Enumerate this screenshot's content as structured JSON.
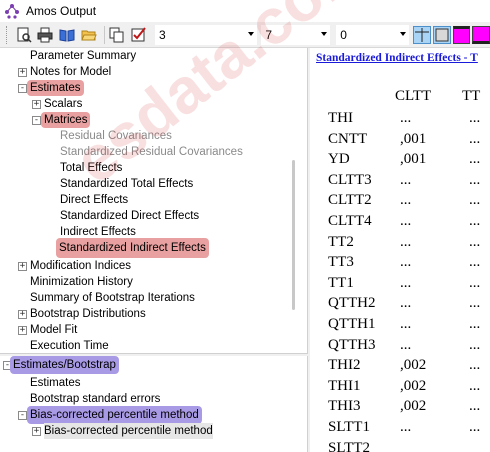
{
  "window": {
    "title": "Amos Output"
  },
  "toolbar": {
    "combo1": "3",
    "combo2": "7",
    "combo3": "0"
  },
  "tree_top": [
    {
      "label": "Parameter Summary"
    },
    {
      "label": "Notes for Model"
    },
    {
      "label": "Estimates"
    },
    {
      "label": "Scalars"
    },
    {
      "label": "Matrices"
    },
    {
      "label": "Residual Covariances"
    },
    {
      "label": "Standardized Residual Covariances"
    },
    {
      "label": "Total Effects"
    },
    {
      "label": "Standardized Total Effects"
    },
    {
      "label": "Direct Effects"
    },
    {
      "label": "Standardized Direct Effects"
    },
    {
      "label": "Indirect Effects"
    },
    {
      "label": "Standardized Indirect Effects"
    },
    {
      "label": "Modification Indices"
    },
    {
      "label": "Minimization History"
    },
    {
      "label": "Summary of Bootstrap Iterations"
    },
    {
      "label": "Bootstrap Distributions"
    },
    {
      "label": "Model Fit"
    },
    {
      "label": "Execution Time"
    }
  ],
  "tree_bottom": [
    {
      "label": "Estimates/Bootstrap"
    },
    {
      "label": "Estimates"
    },
    {
      "label": "Bootstrap standard errors"
    },
    {
      "label": "Bias-corrected percentile method"
    },
    {
      "label": "Bias-corrected percentile method"
    }
  ],
  "report": {
    "section_link": "Standardized Indirect Effects - T",
    "columns": [
      "CLTT",
      "TT"
    ],
    "rows": [
      {
        "name": "THI",
        "cltt": "...",
        "tt": "..."
      },
      {
        "name": "CNTT",
        "cltt": ",001",
        "tt": "..."
      },
      {
        "name": "YD",
        "cltt": ",001",
        "tt": "..."
      },
      {
        "name": "CLTT3",
        "cltt": "...",
        "tt": "..."
      },
      {
        "name": "CLTT2",
        "cltt": "...",
        "tt": "..."
      },
      {
        "name": "CLTT4",
        "cltt": "...",
        "tt": "..."
      },
      {
        "name": "TT2",
        "cltt": "...",
        "tt": "..."
      },
      {
        "name": "TT3",
        "cltt": "...",
        "tt": "..."
      },
      {
        "name": "TT1",
        "cltt": "...",
        "tt": "..."
      },
      {
        "name": "QTTH2",
        "cltt": "...",
        "tt": "..."
      },
      {
        "name": "QTTH1",
        "cltt": "...",
        "tt": "..."
      },
      {
        "name": "QTTH3",
        "cltt": "...",
        "tt": "..."
      },
      {
        "name": "THI2",
        "cltt": ",002",
        "tt": "..."
      },
      {
        "name": "THI1",
        "cltt": ",002",
        "tt": "..."
      },
      {
        "name": "THI3",
        "cltt": ",002",
        "tt": "..."
      },
      {
        "name": "SLTT1",
        "cltt": "...",
        "tt": "..."
      },
      {
        "name": "SLTT2",
        "cltt": "",
        "tt": ""
      }
    ]
  },
  "watermark": "esdata.com.vn",
  "colors": {
    "highlight_red": "#e8a0a0",
    "highlight_blue": "#a99ae6",
    "link_blue": "#1a1adb",
    "magenta": "#ff00ff"
  }
}
